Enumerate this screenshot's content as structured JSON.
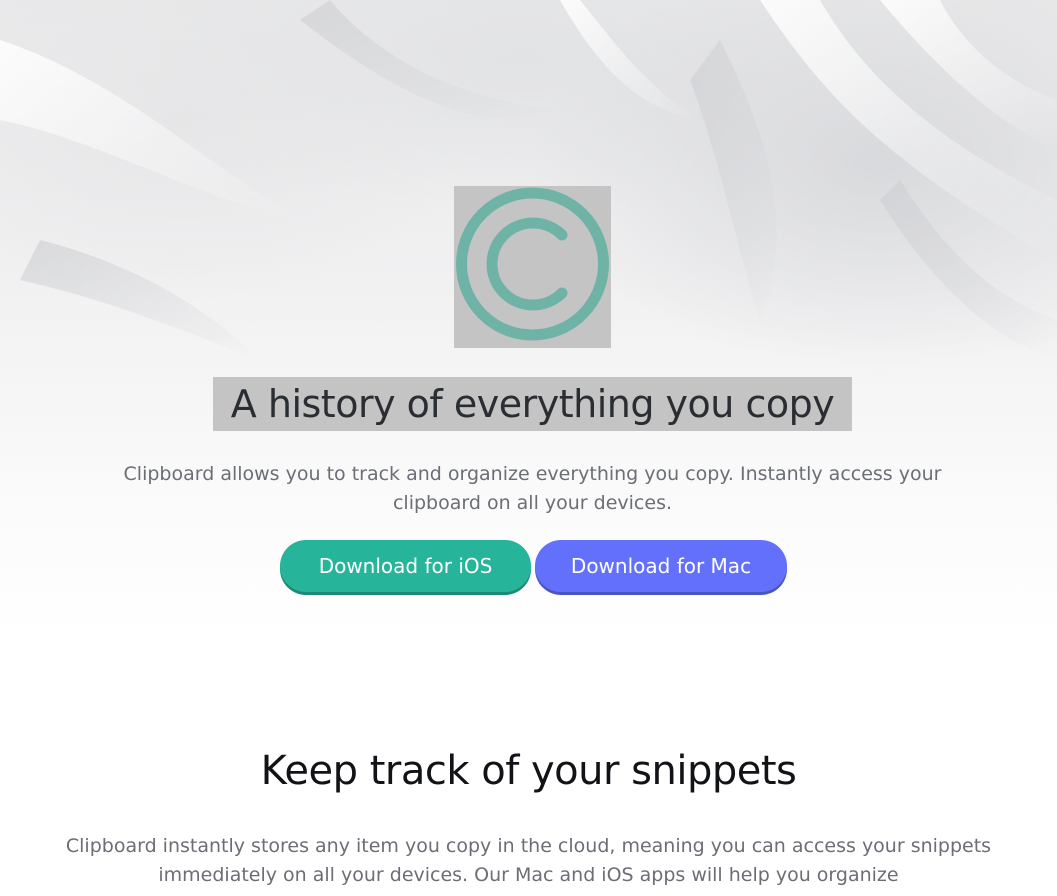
{
  "hero": {
    "logo_icon": "copyright-c-icon",
    "title": "A history of everything you copy",
    "subtitle": "Clipboard allows you to track and organize everything you copy. Instantly access your clipboard on all your devices.",
    "buttons": {
      "ios_label": "Download for iOS",
      "mac_label": "Download for Mac"
    }
  },
  "section": {
    "title": "Keep track of your snippets",
    "text": "Clipboard instantly stores any item you copy in the cloud, meaning you can access your snippets immediately on all your devices. Our Mac and iOS apps will help you organize"
  },
  "colors": {
    "accent_teal": "#26b59b",
    "accent_blue": "#6370fb",
    "logo_teal": "#6eb3a6",
    "placeholder_gray": "#c4c4c4"
  }
}
